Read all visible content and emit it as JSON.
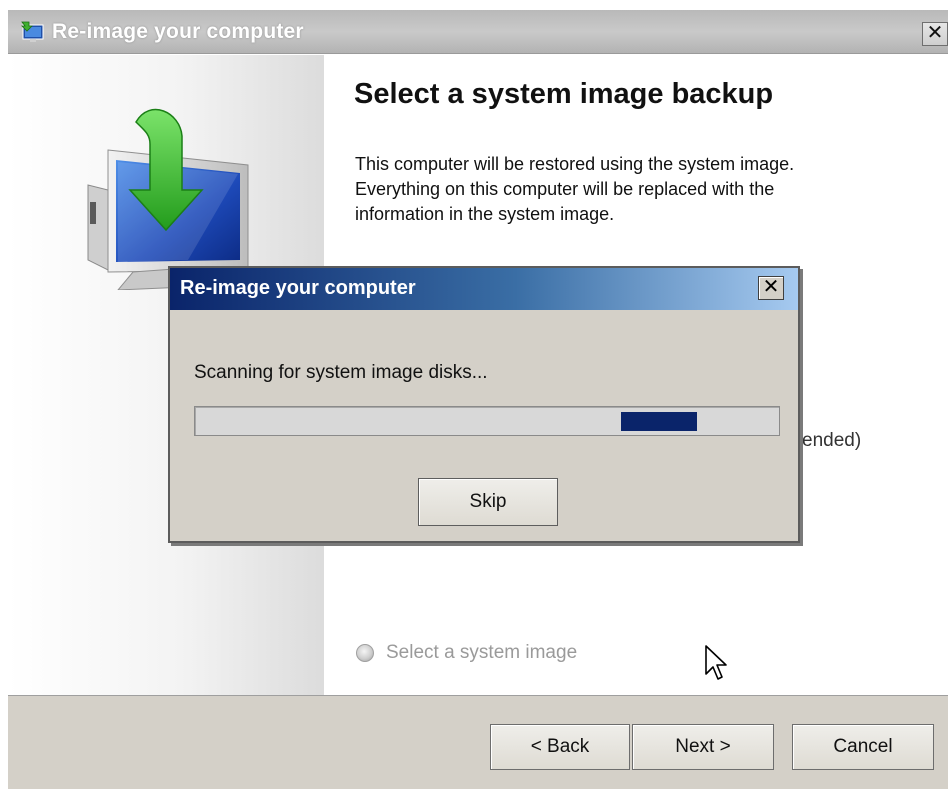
{
  "window": {
    "title": "Re-image your computer",
    "close_glyph": "✕",
    "app_icon": "backup-restore-icon"
  },
  "page": {
    "heading": "Select a system image backup",
    "description_lines": [
      "This computer will be restored using the system image.",
      "Everything on this computer will be replaced with the",
      "information in the system image."
    ],
    "obscured_option_fragment": "ended)",
    "select_image_option": {
      "label": "Select a system image",
      "enabled": false
    },
    "illustration": "monitor-with-green-arrow-icon"
  },
  "footer": {
    "back_label": "< Back",
    "next_label": "Next >",
    "cancel_label": "Cancel"
  },
  "modal": {
    "title": "Re-image your computer",
    "close_glyph": "✕",
    "status_text": "Scanning for system image disks...",
    "progress": {
      "style": "marquee",
      "chunk_start_fraction": 0.73,
      "chunk_width_fraction": 0.13
    },
    "skip_label": "Skip"
  },
  "colors": {
    "modal_title_start": "#0a246a",
    "modal_title_end": "#a6caf0",
    "progress_chunk": "#0a246a",
    "arrow_green": "#3fb02f"
  }
}
